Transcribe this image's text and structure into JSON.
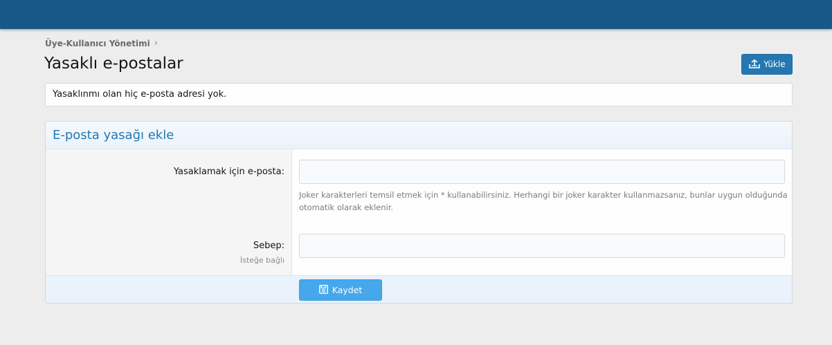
{
  "header": {
    "breadcrumb": "Üye-Kullanıcı Yönetimi",
    "breadcrumb_sep": "›",
    "title": "Yasaklı e-postalar",
    "upload_label": "Yükle",
    "upload_icon": "upload-icon"
  },
  "notice": {
    "text": "Yasaklınmı olan hiç e-posta adresi yok."
  },
  "form": {
    "title": "E-posta yasağı ekle",
    "email": {
      "label": "Yasaklamak için e-posta:",
      "value": "",
      "explain": "Joker karakterleri temsil etmek için * kullanabilirsiniz. Herhangi bir joker karakter kullanmazsanız, bunlar uygun olduğunda otomatik olarak eklenir."
    },
    "reason": {
      "label": "Sebep:",
      "hint": "İsteğe bağlı",
      "value": ""
    },
    "save_label": "Kaydet",
    "save_icon": "save-icon"
  },
  "colors": {
    "topbar": "#185886",
    "accent": "#2577b1",
    "save_button": "#47a7eb"
  }
}
